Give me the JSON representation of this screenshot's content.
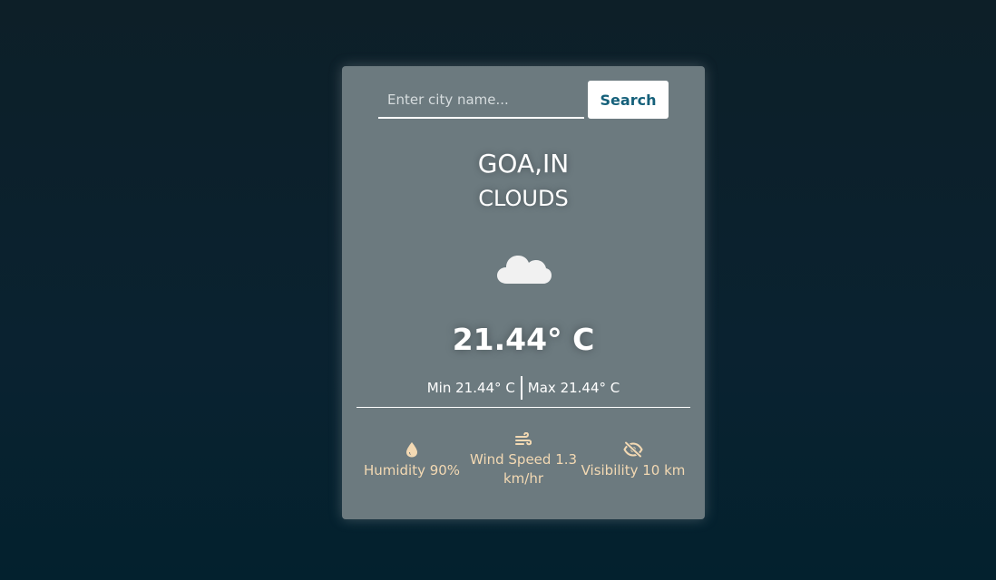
{
  "search": {
    "placeholder": "Enter city name...",
    "value": "",
    "button_label": "Search"
  },
  "location": "GOA,IN",
  "condition": "CLOUDS",
  "condition_icon": "cloud-icon",
  "temperature": "21.44° C",
  "min_label": "Min 21.44° C",
  "max_label": "Max 21.44° C",
  "stats": {
    "humidity": {
      "icon": "droplet-icon",
      "label": "Humidity 90%"
    },
    "wind": {
      "icon": "wind-icon",
      "label": "Wind Speed 1.3 km/hr"
    },
    "visibility": {
      "icon": "eye-slash-icon",
      "label": "Visibility 10 km"
    }
  },
  "colors": {
    "card_background": "#6c7a7f",
    "button_text": "#15607a",
    "stat_text": "#f3d9b3",
    "page_background": "#0a2230"
  }
}
